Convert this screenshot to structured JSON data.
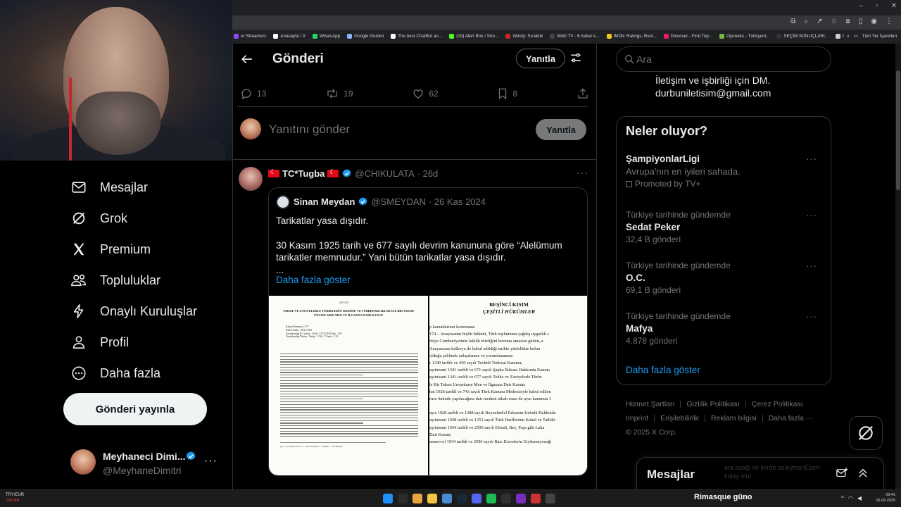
{
  "bookmarks": {
    "items": [
      {
        "label": "or Streamers",
        "color": "#9146ff"
      },
      {
        "label": "Anasayfa / X",
        "color": "#ffffff"
      },
      {
        "label": "WhatsApp",
        "color": "#25d366"
      },
      {
        "label": "Google Gemini",
        "color": "#8ab4f8"
      },
      {
        "label": "The best ChatBot an...",
        "color": "#ffffff"
      },
      {
        "label": "(19) Alert Box / Stre...",
        "color": "#53fc18"
      },
      {
        "label": "Windy: Sıcaklık",
        "color": "#c62828"
      },
      {
        "label": "Multi TV - 6 haber k...",
        "color": "#444444"
      },
      {
        "label": "IMDb: Ratings, Revi...",
        "color": "#f5c518"
      },
      {
        "label": "Discover - Find Top...",
        "color": "#e91e63"
      },
      {
        "label": "Oyuneks - Türkiyeni...",
        "color": "#7cb342"
      },
      {
        "label": "SEÇİM SONUÇLARI...",
        "color": "#333333"
      },
      {
        "label": "ChatGPT",
        "color": "#cccccc"
      }
    ],
    "overflow": "»",
    "all_bookmarks": "Tüm Yer İşaretleri"
  },
  "sidebar": {
    "nav": [
      {
        "label": "Mesajlar",
        "icon": "envelope-icon"
      },
      {
        "label": "Grok",
        "icon": "grok-icon"
      },
      {
        "label": "Premium",
        "icon": "x-logo-icon"
      },
      {
        "label": "Topluluklar",
        "icon": "people-icon"
      },
      {
        "label": "Onaylı Kuruluşlar",
        "icon": "lightning-icon"
      },
      {
        "label": "Profil",
        "icon": "person-icon"
      },
      {
        "label": "Daha fazla",
        "icon": "more-circle-icon"
      }
    ],
    "post_button": "Gönderi yayınla",
    "account": {
      "name": "Meyhaneci Dimi...",
      "handle": "@MeyhaneDimitri",
      "more": "···"
    }
  },
  "main": {
    "title": "Gönderi",
    "reply_pill": "Yanıtla",
    "stats": {
      "replies": "13",
      "reposts": "19",
      "likes": "62",
      "bookmarks": "8"
    },
    "compose": {
      "placeholder": "Yanıtını gönder",
      "button": "Yanıtla"
    },
    "tweet": {
      "name": "TC*Tugba",
      "handle": "@CHIKULATA",
      "time": "· 26d",
      "more": "···",
      "quote": {
        "name": "Sinan Meydan",
        "handle": "@SMEYDAN",
        "time": "· 26 Kas 2024",
        "line1": "Tarikatlar yasa dışıdır.",
        "line2": "30 Kasım 1925 tarih ve 677 sayılı devrim kanununa göre “Alelümum",
        "line3": "tarikatler memnudur.” Yani bütün tarikatlar yasa dışıdır.",
        "line4": "...",
        "show_more": "Daha fazla göster"
      },
      "doc_left": {
        "page_no": "289 200",
        "heading": "TEKKE VE ZAVİYELERLE TÜRBELERİN SEDDİNE VE TÜRBEDARLIKLAR İLE BİR TAKIM UNVANLARIN MEN VE İLGASINA DAİR KANUN",
        "meta1": "Kanun Numarası : 677",
        "meta2": "Kabul Tarihi : 30/11/1925",
        "meta3": "Yayımlandığı R. Gazete : Tarih : 13/12/1925 Sayı : 243",
        "meta4": "Yayımlandığı Düstur : Tertip : 3 Cilt : 7 Sayfa : 113",
        "footnote": "(1) 1/12/1960 tarih ve 5... sayılı Kanunla ... hüküm ... eklenmiştir."
      },
      "doc_right": {
        "heading1": "BEŞİNCİ KISIM",
        "heading2": "ÇEŞİTLİ HÜKÜMLER",
        "lines": [
          "p kanunlarının korunması",
          "174 – Anayasanın hiçbir hükmü, Türk toplumunu çağdaş uygarlık s",
          "rkiye Cumhuriyetinin laiklik niteliğini koruma amacını güden, a",
          "Anayasanın halkoyu ile kabul edildiği tarihte yürürlükte bulun",
          "olduğu şeklinde anlaşılamaz ve yorumlanamaz:",
          "r 1340 tarihli ve 430 sayılı Tevhidi Tedrisat Kanunu;",
          "eşrinisani 1341 tarihli ve 671 sayılı Şapka İktisası Hakkında Kanun;",
          "eşrinisani 1341 tarihli ve 677 sayılı Tekke ve Zaviyelerle Türbe",
          "le Bir Takım Unvanların Men ve İlgasına Dair Kanun;",
          "bat 1926 tarihli ve 743 sayılı Türk Kanunu Medenisiyle kabul edilen",
          "ruru önünde yapılacağına dair medeni nikah esası ile aynı kanunun 1",
          "",
          "ayıs 1928 tarihli ve 1288 sayılı Beynelmilel Erkamın Kabulü Hakkında",
          "eşrinisani 1928 tarihli ve 1353 sayılı Türk Harflerinin Kabul ve Tatbiki",
          "eşrinisani 1934 tarihli ve 2590 sayılı Efendi, Bey, Paşa gibi Laka",
          "Dair Kanun;",
          "unuevvel 1934 tarihli ve 2596 sayılı Bazı Kisvelerin Giyilemeyeceği"
        ]
      }
    }
  },
  "right": {
    "search_placeholder": "Ara",
    "bio_line1": "İletişim ve işbirliği için DM.",
    "bio_line2": "durbuniletisim@gmail.com",
    "trends_title": "Neler oluyor?",
    "trends": [
      {
        "context": "",
        "name": "ŞampiyonlarLigi",
        "sub": "Avrupa'nın en iyileri sahada.",
        "promo": "Promoted by TV+"
      },
      {
        "context": "Türkiye tarihinde gündemde",
        "name": "Sedat Peker",
        "sub": "32,4 B gönderi",
        "promo": ""
      },
      {
        "context": "Türkiye tarihinde gündemde",
        "name": "O.C.",
        "sub": "69,1 B gönderi",
        "promo": ""
      },
      {
        "context": "Türkiye tarihinde gündemde",
        "name": "Mafya",
        "sub": "4.878 gönderi",
        "promo": ""
      }
    ],
    "trends_more": "Daha fazla göster",
    "footer": {
      "links1": [
        "Hizmet Şartları",
        "Gizlilik Politikası",
        "Çerez Politikası"
      ],
      "links2": [
        "Imprint",
        "Erişilebilirlik",
        "Reklam bilgisi",
        "Daha fazla ···"
      ],
      "copyright": "© 2025 X Corp."
    },
    "messages_title": "Mesajlar",
    "messages_ghost_line1": "ara aşağı ile ilerde süleymanEzerr",
    "messages_ghost_line2": "kolay olur"
  },
  "taskbar": {
    "weather_line1": "TRY/EUR",
    "weather_line2": "-%0,48",
    "caption_part1": "Rimasque",
    "caption_part2": "güno",
    "time": "09:41",
    "date": "16.09.2025",
    "apps": [
      {
        "name": "windows-start-icon",
        "color": "#1e90ff"
      },
      {
        "name": "search-taskbar-icon",
        "color": "#2b2b2b"
      },
      {
        "name": "chrome-icon",
        "color": "#e8a33c"
      },
      {
        "name": "file-explorer-icon",
        "color": "#f4c542"
      },
      {
        "name": "store-icon",
        "color": "#4b8bd4"
      },
      {
        "name": "steam-icon",
        "color": "#1b2838"
      },
      {
        "name": "discord-icon",
        "color": "#5865f2"
      },
      {
        "name": "spotify-icon",
        "color": "#1db954"
      },
      {
        "name": "obs-icon",
        "color": "#303030"
      },
      {
        "name": "app-badge-icon",
        "color": "#7b2cbf"
      },
      {
        "name": "mic-app-icon",
        "color": "#cc3333"
      },
      {
        "name": "settings-icon",
        "color": "#444444"
      }
    ]
  }
}
